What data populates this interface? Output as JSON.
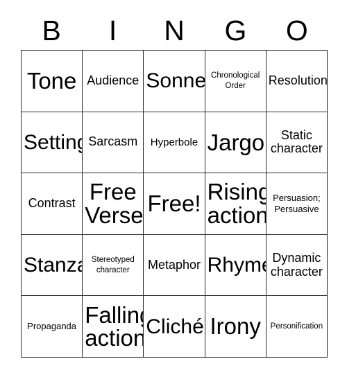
{
  "header": {
    "letters": [
      "B",
      "I",
      "N",
      "G",
      "O"
    ]
  },
  "grid": {
    "rows": 5,
    "columns": 5,
    "border_color": "#2b2b2b",
    "background_color": "#ffffff",
    "text_color": "#000000",
    "cells": [
      {
        "text": "Tone",
        "size": "xl"
      },
      {
        "text": "Audience",
        "size": "md"
      },
      {
        "text": "Sonnet",
        "size": "lg"
      },
      {
        "text": "Chronological\nOrder",
        "size": "xxs"
      },
      {
        "text": "Resolution",
        "size": "md"
      },
      {
        "text": "Setting",
        "size": "lg"
      },
      {
        "text": "Sarcasm",
        "size": "md"
      },
      {
        "text": "Hyperbole",
        "size": "sm"
      },
      {
        "text": "Jargon",
        "size": "xl"
      },
      {
        "text": "Static\ncharacter",
        "size": "md"
      },
      {
        "text": "Contrast",
        "size": "md"
      },
      {
        "text": "Free\nVerse",
        "size": "xl"
      },
      {
        "text": "Free!",
        "size": "xl"
      },
      {
        "text": "Rising\naction",
        "size": "xl"
      },
      {
        "text": "Persuasion;\nPersuasive",
        "size": "xs"
      },
      {
        "text": "Stanza",
        "size": "lg"
      },
      {
        "text": "Stereotyped\ncharacter",
        "size": "xxs"
      },
      {
        "text": "Metaphor",
        "size": "md"
      },
      {
        "text": "Rhyme",
        "size": "lg"
      },
      {
        "text": "Dynamic\ncharacter",
        "size": "md"
      },
      {
        "text": "Propaganda",
        "size": "xs"
      },
      {
        "text": "Falling\naction",
        "size": "xl"
      },
      {
        "text": "Cliché",
        "size": "lg"
      },
      {
        "text": "Irony",
        "size": "xl"
      },
      {
        "text": "Personification",
        "size": "xxs"
      }
    ]
  }
}
